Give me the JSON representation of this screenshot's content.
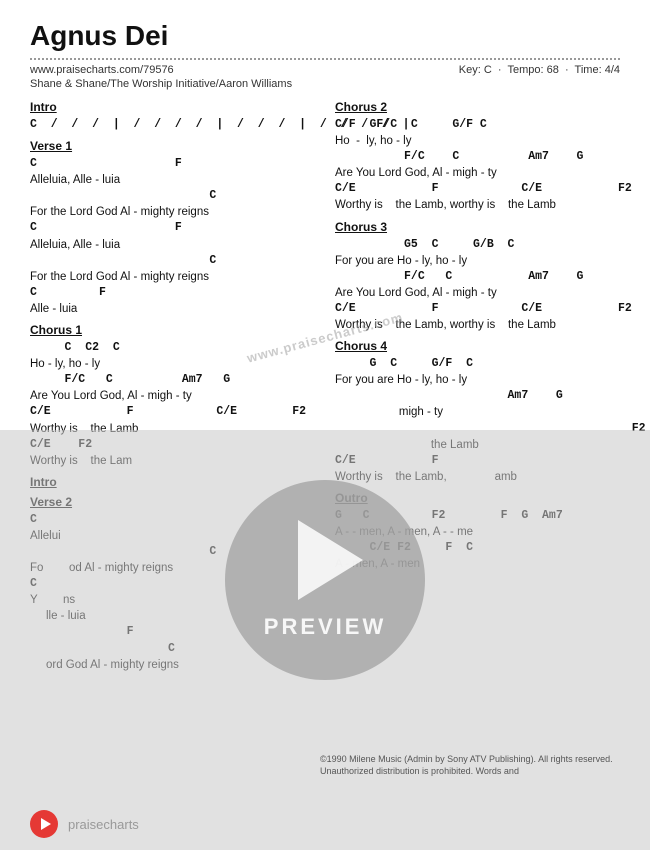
{
  "title": "Agnus Dei",
  "url": "www.praisecharts.com/79576",
  "key": "Key: C",
  "tempo": "Tempo: 68",
  "time": "Time: 4/4",
  "artist": "Shane & Shane/The Worship Initiative/Aaron Williams",
  "separators": {
    "dot_line": "·"
  },
  "left_column": [
    {
      "id": "intro",
      "title": "Intro",
      "lines": [
        {
          "type": "chord",
          "text": "C  /  /  /  |  /  /  /  /  |  /  /  /  |  /  /  /  /  |"
        }
      ]
    },
    {
      "id": "verse1",
      "title": "Verse 1",
      "lines": [
        {
          "type": "chord",
          "text": "C                    F"
        },
        {
          "type": "lyric",
          "text": "Alleluia, Alle - luia"
        },
        {
          "type": "chord",
          "text": "                          C"
        },
        {
          "type": "lyric",
          "text": "For the Lord God Al - mighty reigns"
        },
        {
          "type": "chord",
          "text": "C                    F"
        },
        {
          "type": "lyric",
          "text": "Alleluia, Alle - luia"
        },
        {
          "type": "chord",
          "text": "                          C"
        },
        {
          "type": "lyric",
          "text": "For the Lord God Al - mighty reigns"
        },
        {
          "type": "chord",
          "text": "C         F"
        },
        {
          "type": "lyric",
          "text": "Alle - luia"
        }
      ]
    },
    {
      "id": "chorus1",
      "title": "Chorus 1",
      "lines": [
        {
          "type": "chord",
          "text": "     C  C2  C"
        },
        {
          "type": "lyric",
          "text": "Ho - ly, ho - ly"
        },
        {
          "type": "chord",
          "text": "     F/C   C          Am7   G"
        },
        {
          "type": "lyric",
          "text": "Are You Lord God, Al - migh - ty"
        },
        {
          "type": "chord",
          "text": "C/E           F            C/E        F2"
        },
        {
          "type": "lyric",
          "text": "Worthy is    the Lamb"
        },
        {
          "type": "chord",
          "text": "C/E    F2"
        },
        {
          "type": "lyric",
          "text": "Worthy is    the Lam"
        }
      ]
    },
    {
      "id": "intro2",
      "title": "Intro",
      "lines": []
    },
    {
      "id": "verse2",
      "title": "Verse 2",
      "lines": [
        {
          "type": "chord",
          "text": "C"
        },
        {
          "type": "lyric",
          "text": "Allelui"
        },
        {
          "type": "chord",
          "text": "                          C"
        },
        {
          "type": "lyric",
          "text": "Fo        od Al - mighty reigns"
        },
        {
          "type": "chord",
          "text": "C"
        },
        {
          "type": "lyric",
          "text": "Y        ns"
        },
        {
          "type": "lyric",
          "text": "     lle - luia"
        },
        {
          "type": "chord",
          "text": "              F"
        },
        {
          "type": "chord",
          "text": "                    C"
        },
        {
          "type": "lyric",
          "text": "     ord God Al - mighty reigns"
        }
      ]
    }
  ],
  "right_column": [
    {
      "id": "chorus2",
      "title": "Chorus 2",
      "lines": [
        {
          "type": "chord",
          "text": "C/F  GF/C  C     G/F C"
        },
        {
          "type": "lyric",
          "text": "Ho  -  ly, ho - ly"
        },
        {
          "type": "chord",
          "text": "          F/C    C          Am7    G"
        },
        {
          "type": "lyric",
          "text": "Are You Lord God, Al - migh - ty"
        },
        {
          "type": "chord",
          "text": "C/E           F            C/E           F2"
        },
        {
          "type": "lyric",
          "text": "Worthy is    the Lamb, worthy is    the Lamb"
        }
      ]
    },
    {
      "id": "chorus3",
      "title": "Chorus 3",
      "lines": [
        {
          "type": "chord",
          "text": "          G5  C     G/B  C"
        },
        {
          "type": "lyric",
          "text": "For you are Ho - ly, ho - ly"
        },
        {
          "type": "chord",
          "text": "          F/C   C           Am7    G"
        },
        {
          "type": "lyric",
          "text": "Are You Lord God, Al - migh - ty"
        },
        {
          "type": "chord",
          "text": "C/E           F            C/E           F2"
        },
        {
          "type": "lyric",
          "text": "Worthy is    the Lamb, worthy is    the Lamb"
        }
      ]
    },
    {
      "id": "chorus4",
      "title": "Chorus 4",
      "lines": [
        {
          "type": "chord",
          "text": "     G  C     G/F  C"
        },
        {
          "type": "lyric",
          "text": "For you are Ho - ly, ho - ly"
        },
        {
          "type": "chord",
          "text": "                         Am7    G"
        },
        {
          "type": "lyric",
          "text": "                    migh - ty"
        },
        {
          "type": "chord",
          "text": "                                           F2"
        },
        {
          "type": "lyric",
          "text": "                              the Lamb"
        },
        {
          "type": "chord",
          "text": "C/E           F"
        },
        {
          "type": "lyric",
          "text": "Worthy is    the Lamb,               amb"
        }
      ]
    },
    {
      "id": "outro",
      "title": "Outro",
      "lines": [
        {
          "type": "chord",
          "text": "G   C         F2        F  G  Am7"
        },
        {
          "type": "lyric",
          "text": "A - - men, A - men, A - - me"
        },
        {
          "type": "chord",
          "text": "     C/E F2     F  C"
        },
        {
          "type": "lyric",
          "text": "A - men, A - men"
        }
      ]
    }
  ],
  "copyright": "©1990 Milene Music (Admin by Sony ATV Publishing). All rights reserved. Unauthorized distribution is prohibited. Words and",
  "preview": {
    "label": "PREVIEW",
    "watermark": "www.praisecharts.com"
  },
  "footer": {
    "text": "praisecharts"
  }
}
